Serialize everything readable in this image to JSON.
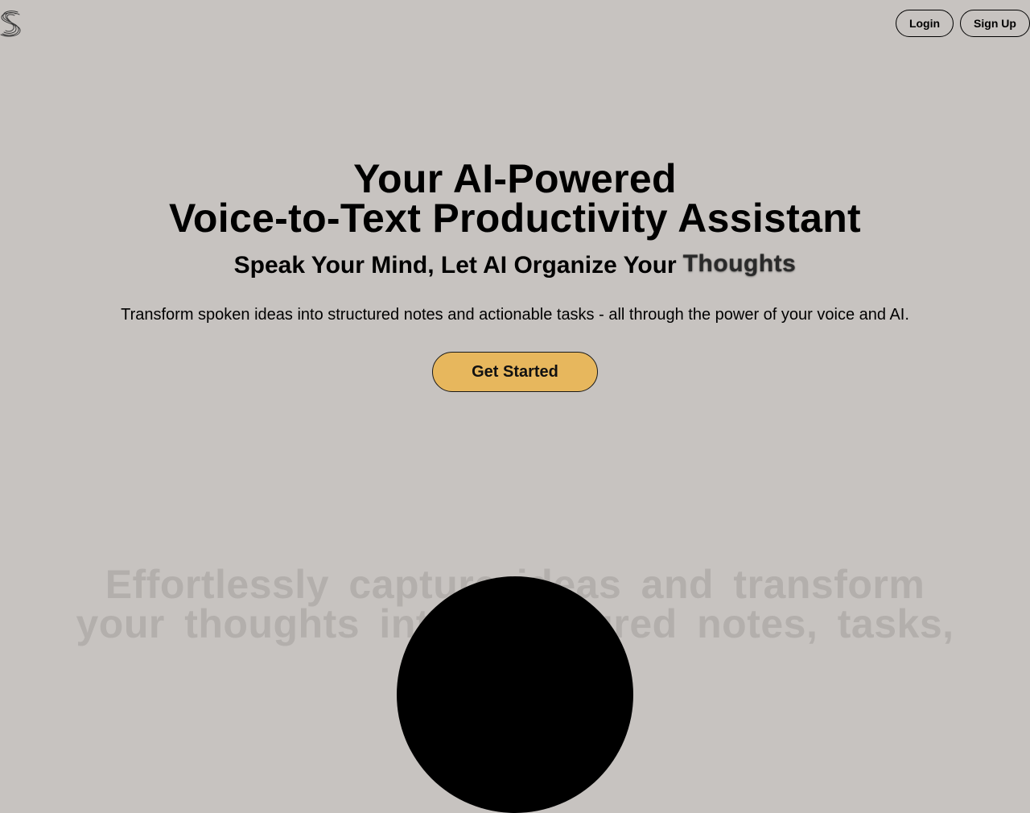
{
  "nav": {
    "login_label": "Login",
    "signup_label": "Sign Up"
  },
  "logo": {
    "icon": "s-logo-icon"
  },
  "hero": {
    "title_line1": "Your AI-Powered",
    "title_line2": "Voice-to-Text Productivity Assistant",
    "subtitle_static": "Speak Your Mind, Let AI Organize Your",
    "subtitle_rotating": "Thoughts",
    "description": "Transform spoken ideas into structured notes and actionable tasks - all through the power of your voice and AI.",
    "cta_label": "Get Started"
  },
  "scroll_section": {
    "line1": "Effortlessly capture ideas and transform",
    "line2": "your thoughts into structured notes, tasks,"
  },
  "colors": {
    "background": "#c7c3c0",
    "cta": "#e7b75d",
    "ghost_text": "#b3afac"
  }
}
